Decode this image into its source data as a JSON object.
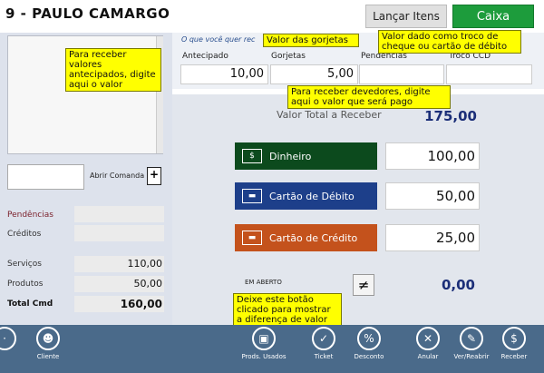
{
  "header": {
    "title": "9 - PAULO CAMARGO",
    "lancar_label": "Lançar Itens",
    "caixa_label": "Caixa"
  },
  "left": {
    "abrir_comanda": "Abrir Comanda",
    "pendencias_label": "Pendências",
    "creditos_label": "Créditos",
    "servicos_label": "Serviços",
    "servicos_value": "110,00",
    "produtos_label": "Produtos",
    "produtos_value": "50,00",
    "total_label": "Total Cmd",
    "total_value": "160,00"
  },
  "top_fields": {
    "hint": "O que você quer rec",
    "antecipado_label": "Antecipado",
    "antecipado_value": "10,00",
    "gorjetas_label": "Gorjetas",
    "gorjetas_value": "5,00",
    "pendencias_label": "Pendências",
    "pendencias_value": "",
    "troco_label": "Troco CCD",
    "troco_value": ""
  },
  "main": {
    "total_label": "Valor Total a Receber",
    "total_value": "175,00",
    "payments": [
      {
        "label": "Dinheiro",
        "value": "100,00",
        "color": "#0c4a1d"
      },
      {
        "label": "Cartão de Débito",
        "value": "50,00",
        "color": "#1d3f8a"
      },
      {
        "label": "Cartão de Crédito",
        "value": "25,00",
        "color": "#c4521c"
      }
    ],
    "em_aberto_label": "EM ABERTO",
    "em_aberto_value": "0,00",
    "neq_symbol": "≠"
  },
  "notes": {
    "antecipado": "Para receber valores\nantecipados, digite\naqui o valor",
    "gorjetas": "Valor das gorjetas",
    "troco": "Valor  dado como troco de\ncheque ou cartão de débito",
    "devedores": "Para receber devedores, digite\naqui o valor que será pago",
    "diferenca": "Deixe este botão\nclicado para mostrar\na diferença de valor"
  },
  "toolbar": {
    "items": [
      {
        "label": "Cliente",
        "icon": "person-icon"
      },
      {
        "label": "Prods. Usados",
        "icon": "box-icon"
      },
      {
        "label": "Ticket",
        "icon": "ticket-icon"
      },
      {
        "label": "Desconto",
        "icon": "percent-icon"
      },
      {
        "label": "Anular",
        "icon": "trash-icon"
      },
      {
        "label": "Ver/Reabrir",
        "icon": "edit-icon"
      },
      {
        "label": "Receber",
        "icon": "cash-icon"
      }
    ]
  },
  "colors": {
    "caixa": "#1d9c3c",
    "toolbar": "#4a6a8a",
    "note": "#ffff00",
    "total": "#1b2e78"
  }
}
